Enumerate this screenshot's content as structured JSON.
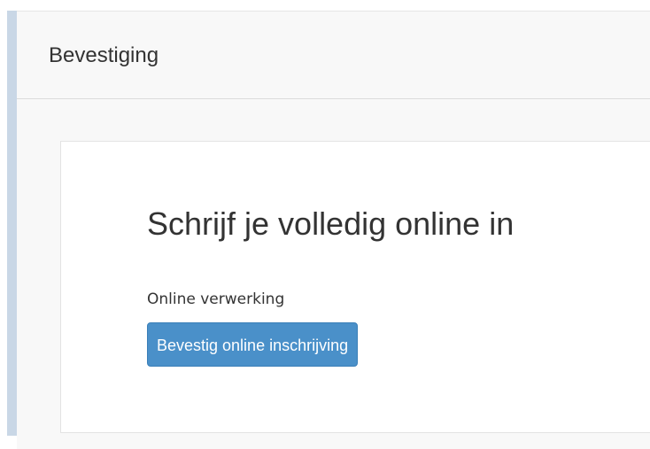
{
  "panel": {
    "title": "Bevestiging"
  },
  "card": {
    "heading": "Schrijf je volledig online in",
    "label": "Online verwerking",
    "button_label": "Bevestig online inschrijving"
  },
  "colors": {
    "accent": "#c9d7e6",
    "button": "#4a90c9",
    "panel_bg": "#f8f8f8"
  }
}
